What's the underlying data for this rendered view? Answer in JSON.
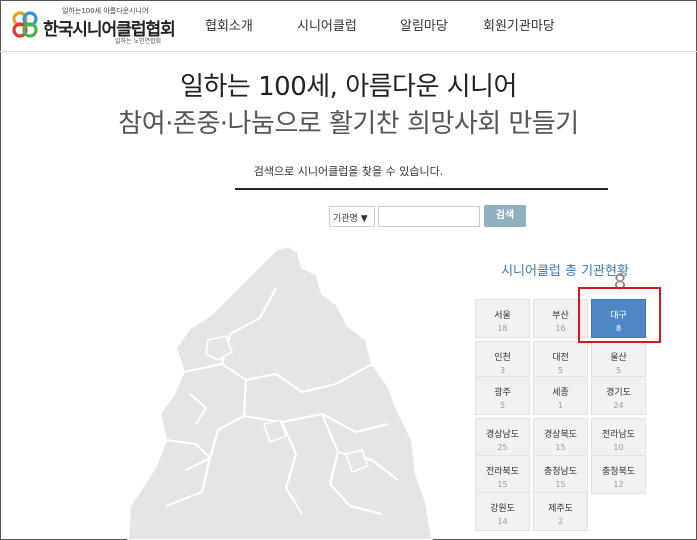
{
  "header": {
    "logo": {
      "tagline": "일하는100세 아름다운시니어",
      "name": "한국시니어클럽협회",
      "subtitle": "일하는 노인연합회"
    },
    "nav": [
      {
        "label": "협회소개"
      },
      {
        "label": "시니어클럽"
      },
      {
        "label": "알림마당"
      },
      {
        "label": "회원기관마당"
      }
    ]
  },
  "hero": {
    "line1": "일하는 100세, 아름다운 시니어",
    "line2": "참여·존중·나눔으로 활기찬 희망사회 만들기"
  },
  "search": {
    "caption": "검색으로 시니어클럽을 찾을 수 있습니다.",
    "select_value": "기관명 ▼",
    "input_value": "",
    "button_label": "검색"
  },
  "stats": {
    "title": "시니어클럽 총 기관현황",
    "total": "8",
    "selected_region": "대구",
    "regions": [
      {
        "name": "서울",
        "count": "18"
      },
      {
        "name": "부산",
        "count": "16"
      },
      {
        "name": "대구",
        "count": "8"
      },
      {
        "name": "인천",
        "count": "3"
      },
      {
        "name": "대전",
        "count": "5"
      },
      {
        "name": "울산",
        "count": "5"
      },
      {
        "name": "광주",
        "count": "5"
      },
      {
        "name": "세종",
        "count": "1"
      },
      {
        "name": "경기도",
        "count": "24"
      },
      {
        "name": "경상남도",
        "count": "25"
      },
      {
        "name": "경상북도",
        "count": "15"
      },
      {
        "name": "전라남도",
        "count": "10"
      },
      {
        "name": "전라북도",
        "count": "15"
      },
      {
        "name": "충청남도",
        "count": "15"
      },
      {
        "name": "충청북도",
        "count": "12"
      },
      {
        "name": "강원도",
        "count": "14"
      },
      {
        "name": "제주도",
        "count": "2"
      }
    ]
  },
  "colors": {
    "accent": "#3a7ab8",
    "active_tile": "#4f87c6",
    "highlight_border": "#d41b1b",
    "search_button": "#8fb0bf"
  }
}
